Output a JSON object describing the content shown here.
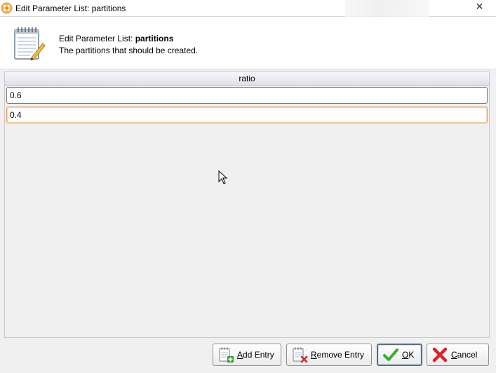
{
  "window": {
    "title": "Edit Parameter List: partitions"
  },
  "header": {
    "line1_prefix": "Edit Parameter List: ",
    "parameter_name": "partitions",
    "description": "The partitions that should be created."
  },
  "table": {
    "column_header": "ratio",
    "rows": [
      {
        "value": "0.6",
        "selected": false
      },
      {
        "value": "0.4",
        "selected": true
      }
    ]
  },
  "buttons": {
    "add_entry": "Add Entry",
    "remove_entry": "Remove Entry",
    "ok": "OK",
    "cancel": "Cancel"
  },
  "icons": {
    "app": "rapidminer-logo-icon",
    "header": "notepad-pencil-icon",
    "add": "notepad-plus-icon",
    "remove": "notepad-x-icon",
    "ok": "checkmark-icon",
    "cancel": "red-x-icon"
  },
  "colors": {
    "selected_row_border": "#e3a157",
    "ok_check": "#3da838",
    "cancel_x": "#d8232a"
  }
}
